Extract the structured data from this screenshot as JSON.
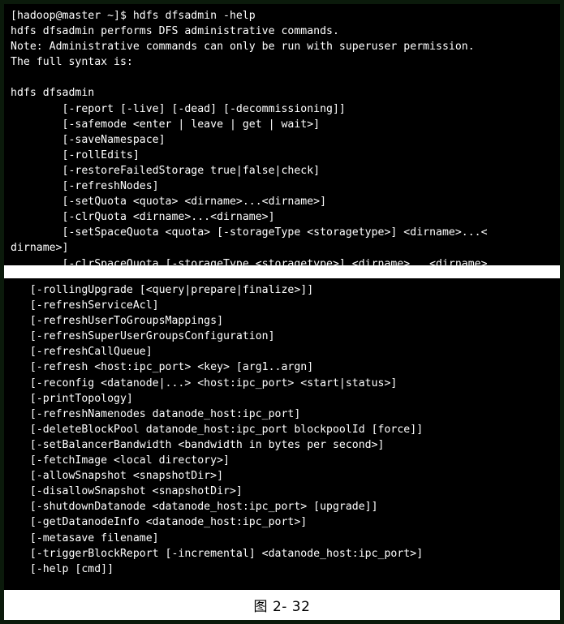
{
  "figure": {
    "caption": "图 2- 32",
    "border_color": "#1e4d1e",
    "terminal_background": "#000000",
    "terminal_foreground": "#ffffff"
  },
  "terminal_block_1": {
    "name": "hdfs-dfsadmin-help-output-part-1",
    "lines": [
      "[hadoop@master ~]$ hdfs dfsadmin -help",
      "hdfs dfsadmin performs DFS administrative commands.",
      "Note: Administrative commands can only be run with superuser permission.",
      "The full syntax is:",
      "",
      "hdfs dfsadmin",
      "        [-report [-live] [-dead] [-decommissioning]]",
      "        [-safemode <enter | leave | get | wait>]",
      "        [-saveNamespace]",
      "        [-rollEdits]",
      "        [-restoreFailedStorage true|false|check]",
      "        [-refreshNodes]",
      "        [-setQuota <quota> <dirname>...<dirname>]",
      "        [-clrQuota <dirname>...<dirname>]",
      "        [-setSpaceQuota <quota> [-storageType <storagetype>] <dirname>...<",
      "dirname>]",
      "        [-clrSpaceQuota [-storageType <storagetype>] <dirname>...<dirname>",
      "]"
    ],
    "prompt": "[hadoop@master ~]$",
    "command": "hdfs dfsadmin -help"
  },
  "terminal_block_2": {
    "name": "hdfs-dfsadmin-help-output-part-2",
    "lines": [
      "   [-rollingUpgrade [<query|prepare|finalize>]]",
      "   [-refreshServiceAcl]",
      "   [-refreshUserToGroupsMappings]",
      "   [-refreshSuperUserGroupsConfiguration]",
      "   [-refreshCallQueue]",
      "   [-refresh <host:ipc_port> <key> [arg1..argn]",
      "   [-reconfig <datanode|...> <host:ipc_port> <start|status>]",
      "   [-printTopology]",
      "   [-refreshNamenodes datanode_host:ipc_port]",
      "   [-deleteBlockPool datanode_host:ipc_port blockpoolId [force]]",
      "   [-setBalancerBandwidth <bandwidth in bytes per second>]",
      "   [-fetchImage <local directory>]",
      "   [-allowSnapshot <snapshotDir>]",
      "   [-disallowSnapshot <snapshotDir>]",
      "   [-shutdownDatanode <datanode_host:ipc_port> [upgrade]]",
      "   [-getDatanodeInfo <datanode_host:ipc_port>]",
      "   [-metasave filename]",
      "   [-triggerBlockReport [-incremental] <datanode_host:ipc_port>]",
      "   [-help [cmd]]"
    ]
  }
}
